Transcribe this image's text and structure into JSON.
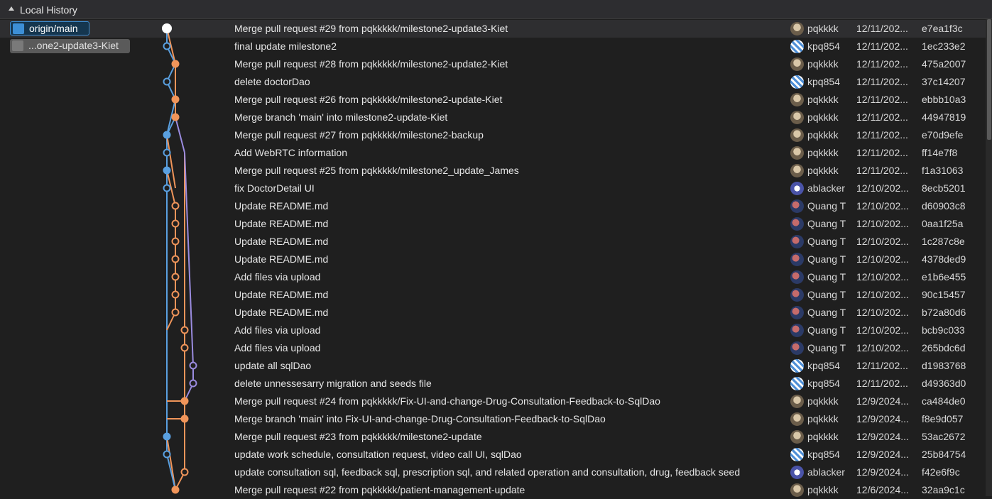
{
  "header": {
    "title": "Local History"
  },
  "branches": [
    {
      "label": "origin/main",
      "icon": "branch-icon"
    },
    {
      "label": "...one2-update3-Kiet",
      "icon": "branch-icon"
    }
  ],
  "colors": {
    "blue": "#5aa0e0",
    "orange": "#f0955a",
    "purple": "#9b8ce0",
    "white": "#ffffff"
  },
  "commits": [
    {
      "message": "Merge pull request #29 from pqkkkkk/milestone2-update3-Kiet",
      "author": "pqkkkk",
      "date": "12/11/202...",
      "sha": "e7ea1f3c"
    },
    {
      "message": "final update milestone2",
      "author": "kpq854",
      "date": "12/11/202...",
      "sha": "1ec233e2"
    },
    {
      "message": "Merge pull request #28 from pqkkkkk/milestone2-update2-Kiet",
      "author": "pqkkkk",
      "date": "12/11/202...",
      "sha": "475a2007"
    },
    {
      "message": "delete doctorDao",
      "author": "kpq854",
      "date": "12/11/202...",
      "sha": "37c14207"
    },
    {
      "message": "Merge pull request #26 from pqkkkkk/milestone2-update-Kiet",
      "author": "pqkkkk",
      "date": "12/11/202...",
      "sha": "ebbb10a3"
    },
    {
      "message": "Merge branch 'main' into milestone2-update-Kiet",
      "author": "pqkkkk",
      "date": "12/11/202...",
      "sha": "44947819"
    },
    {
      "message": "Merge pull request #27 from pqkkkkk/milestone2-backup",
      "author": "pqkkkk",
      "date": "12/11/202...",
      "sha": "e70d9efe"
    },
    {
      "message": "Add WebRTC information",
      "author": "pqkkkk",
      "date": "12/11/202...",
      "sha": "ff14e7f8"
    },
    {
      "message": "Merge pull request #25 from pqkkkkk/milestone2_update_James",
      "author": "pqkkkk",
      "date": "12/11/202...",
      "sha": "f1a31063"
    },
    {
      "message": "fix DoctorDetail UI",
      "author": "ablacker",
      "date": "12/10/202...",
      "sha": "8ecb5201"
    },
    {
      "message": "Update README.md",
      "author": "Quang T",
      "date": "12/10/202...",
      "sha": "d60903c8"
    },
    {
      "message": "Update README.md",
      "author": "Quang T",
      "date": "12/10/202...",
      "sha": "0aa1f25a"
    },
    {
      "message": "Update README.md",
      "author": "Quang T",
      "date": "12/10/202...",
      "sha": "1c287c8e"
    },
    {
      "message": "Update README.md",
      "author": "Quang T",
      "date": "12/10/202...",
      "sha": "4378ded9"
    },
    {
      "message": "Add files via upload",
      "author": "Quang T",
      "date": "12/10/202...",
      "sha": "e1b6e455"
    },
    {
      "message": "Update README.md",
      "author": "Quang T",
      "date": "12/10/202...",
      "sha": "90c15457"
    },
    {
      "message": "Update README.md",
      "author": "Quang T",
      "date": "12/10/202...",
      "sha": "b72a80d6"
    },
    {
      "message": "Add files via upload",
      "author": "Quang T",
      "date": "12/10/202...",
      "sha": "bcb9c033"
    },
    {
      "message": "Add files via upload",
      "author": "Quang T",
      "date": "12/10/202...",
      "sha": "265bdc6d"
    },
    {
      "message": "update all sqlDao",
      "author": "kpq854",
      "date": "12/11/202...",
      "sha": "d1983768"
    },
    {
      "message": "delete unnessesarry migration and seeds file",
      "author": "kpq854",
      "date": "12/11/202...",
      "sha": "d49363d0"
    },
    {
      "message": "Merge pull request #24 from pqkkkkk/Fix-UI-and-change-Drug-Consultation-Feedback-to-SqlDao",
      "author": "pqkkkk",
      "date": "12/9/2024...",
      "sha": "ca484de0"
    },
    {
      "message": "Merge branch 'main' into Fix-UI-and-change-Drug-Consultation-Feedback-to-SqlDao",
      "author": "pqkkkk",
      "date": "12/9/2024...",
      "sha": "f8e9d057"
    },
    {
      "message": "Merge pull request #23 from pqkkkkk/milestone2-update",
      "author": "pqkkkk",
      "date": "12/9/2024...",
      "sha": "53ac2672"
    },
    {
      "message": "update work schedule, consultation request, video call UI, sqlDao",
      "author": "kpq854",
      "date": "12/9/2024...",
      "sha": "25b84754"
    },
    {
      "message": "update consultation sql, feedback sql, prescription sql, and related operation and consultation, drug, feedback seed",
      "author": "ablacker",
      "date": "12/9/2024...",
      "sha": "f42e6f9c"
    },
    {
      "message": "Merge pull request #22 from pqkkkkk/patient-management-update",
      "author": "pqkkkk",
      "date": "12/6/2024...",
      "sha": "32aa9c1c"
    }
  ]
}
